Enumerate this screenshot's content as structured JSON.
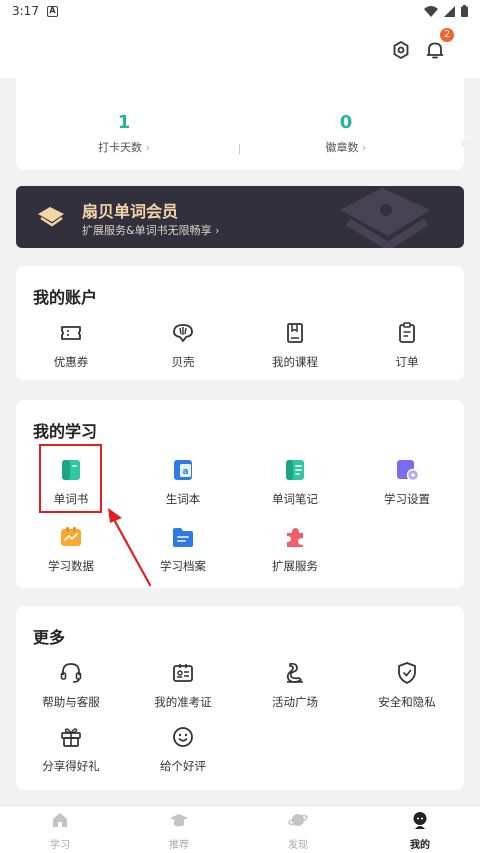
{
  "status_bar": {
    "time": "3:17",
    "app_letter": "A"
  },
  "header": {
    "notification_count": "2"
  },
  "stats": [
    {
      "value": "1",
      "label": "打卡天数"
    },
    {
      "value": "0",
      "label": "徽章数"
    }
  ],
  "vip": {
    "title": "扇贝单词会员",
    "subtitle": "扩展服务&单词书无限畅享"
  },
  "account": {
    "title": "我的账户",
    "items": [
      {
        "label": "优惠券",
        "icon": "coupon-icon"
      },
      {
        "label": "贝壳",
        "icon": "shell-icon"
      },
      {
        "label": "我的课程",
        "icon": "course-icon"
      },
      {
        "label": "订单",
        "icon": "order-icon"
      }
    ]
  },
  "study": {
    "title": "我的学习",
    "items": [
      {
        "label": "单词书",
        "icon": "wordbook-icon"
      },
      {
        "label": "生词本",
        "icon": "vocab-notebook-icon"
      },
      {
        "label": "单词笔记",
        "icon": "word-notes-icon"
      },
      {
        "label": "学习设置",
        "icon": "study-settings-icon"
      },
      {
        "label": "学习数据",
        "icon": "study-data-icon"
      },
      {
        "label": "学习档案",
        "icon": "study-archive-icon"
      },
      {
        "label": "扩展服务",
        "icon": "extension-service-icon"
      }
    ]
  },
  "more": {
    "title": "更多",
    "items": [
      {
        "label": "帮助与客服",
        "icon": "headset-icon"
      },
      {
        "label": "我的准考证",
        "icon": "admission-ticket-icon"
      },
      {
        "label": "活动广场",
        "icon": "activity-icon"
      },
      {
        "label": "安全和隐私",
        "icon": "shield-icon"
      },
      {
        "label": "分享得好礼",
        "icon": "gift-icon"
      },
      {
        "label": "给个好评",
        "icon": "smile-icon"
      }
    ]
  },
  "tabs": [
    {
      "label": "学习",
      "icon": "home-icon"
    },
    {
      "label": "推荐",
      "icon": "graduation-cap-icon"
    },
    {
      "label": "发现",
      "icon": "planet-icon"
    },
    {
      "label": "我的",
      "icon": "profile-icon"
    }
  ],
  "colors": {
    "accent": "#27b59a",
    "vip_bg": "#33303d",
    "vip_gold": "#f4d5a8",
    "badge": "#f0642a",
    "highlight": "#e02020"
  }
}
